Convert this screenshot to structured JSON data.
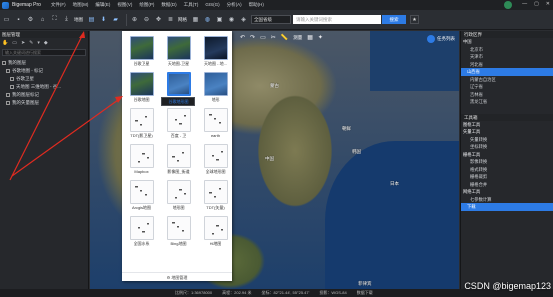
{
  "app": {
    "name": "Bigemap Pro"
  },
  "menu": [
    "文件(F)",
    "地图(M)",
    "编辑(E)",
    "视图(V)",
    "绘图(P)",
    "数据(D)",
    "工具(T)",
    "GIS(G)",
    "分析(A)",
    "帮助(H)"
  ],
  "toolbar": {
    "map_label": "地图",
    "grid_label": "网格",
    "select_value": "全国省级",
    "search_placeholder": "请输入关键词搜索",
    "search_button": "搜索"
  },
  "left_panel": {
    "title": "图层管理",
    "search_placeholder": "输入关键词进行搜索",
    "tree": [
      {
        "label": "我的图层"
      },
      {
        "label": "谷歌地图 - 标记"
      },
      {
        "label": "谷歌卫星"
      },
      {
        "label": "天地图 三维地图 - 谷..."
      },
      {
        "label": "我的图层标记"
      },
      {
        "label": "我的矢量图层"
      }
    ]
  },
  "layer_popup": {
    "tiles": [
      {
        "label": "谷歌卫星",
        "style": "sat"
      },
      {
        "label": "天地图-卫星",
        "style": "sat"
      },
      {
        "label": "天地图 - 地...",
        "style": "dark"
      },
      {
        "label": "谷歌地图",
        "style": "sat"
      },
      {
        "label": "谷歌地形图",
        "style": "terrain",
        "selected": true
      },
      {
        "label": "地形",
        "style": "terrain"
      },
      {
        "label": "TDT(影卫星)",
        "style": "blank"
      },
      {
        "label": "百度 - 卫",
        "style": "blank"
      },
      {
        "label": "earth",
        "style": "blank"
      },
      {
        "label": "Mapbox",
        "style": "blank"
      },
      {
        "label": "影像图_街道",
        "style": "blank"
      },
      {
        "label": "全球地形图",
        "style": "blank"
      },
      {
        "label": "Arcgis地图",
        "style": "blank"
      },
      {
        "label": "地形图",
        "style": "blank"
      },
      {
        "label": "TDT(矢量)",
        "style": "blank"
      },
      {
        "label": "全国水系",
        "style": "blank"
      },
      {
        "label": "Bing地图",
        "style": "blank"
      },
      {
        "label": "Hi地图",
        "style": "blank"
      }
    ],
    "footer": "地图管理"
  },
  "map": {
    "measure_label": "测量",
    "task_label": "任务列表",
    "place_labels": [
      "蒙古",
      "中国",
      "日本",
      "朝鲜",
      "韩国",
      "菲律宾"
    ]
  },
  "right_panel": {
    "title": "行政区界",
    "items": [
      {
        "label": "中国",
        "type": "grp"
      },
      {
        "label": "北京市",
        "type": "sub"
      },
      {
        "label": "天津市",
        "type": "sub"
      },
      {
        "label": "河北省",
        "type": "sub"
      },
      {
        "label": "山西省",
        "type": "hl"
      },
      {
        "label": "内蒙古自治区",
        "type": "sub"
      },
      {
        "label": "辽宁省",
        "type": "sub"
      },
      {
        "label": "吉林省",
        "type": "sub"
      },
      {
        "label": "黑龙江省",
        "type": "sub"
      }
    ],
    "tools_title": "工具箱",
    "tools": [
      {
        "label": "图框工具",
        "type": "grp"
      },
      {
        "label": "矢量工具",
        "type": "grp"
      },
      {
        "label": "矢量转换",
        "type": "sub"
      },
      {
        "label": "坐标转换",
        "type": "sub"
      },
      {
        "label": "栅格工具",
        "type": "grp"
      },
      {
        "label": "影像转换",
        "type": "sub"
      },
      {
        "label": "格式转换",
        "type": "sub"
      },
      {
        "label": "栅格裁剪",
        "type": "sub"
      },
      {
        "label": "栅格合并",
        "type": "sub"
      },
      {
        "label": "网络工具",
        "type": "grp"
      },
      {
        "label": "七参数计算",
        "type": "sub"
      },
      {
        "label": "下载",
        "type": "hl"
      }
    ]
  },
  "status": {
    "scale": "比例尺：1:36978000",
    "elevation": "高程：202.94 米",
    "coords": "坐标：82°21.44', 55°25.47'",
    "projection": "投影：WGS-84",
    "download": "数据下载"
  },
  "watermark": "CSDN @bigemap123",
  "colors": {
    "accent": "#2d7be5",
    "annotation": "#e02b20"
  }
}
